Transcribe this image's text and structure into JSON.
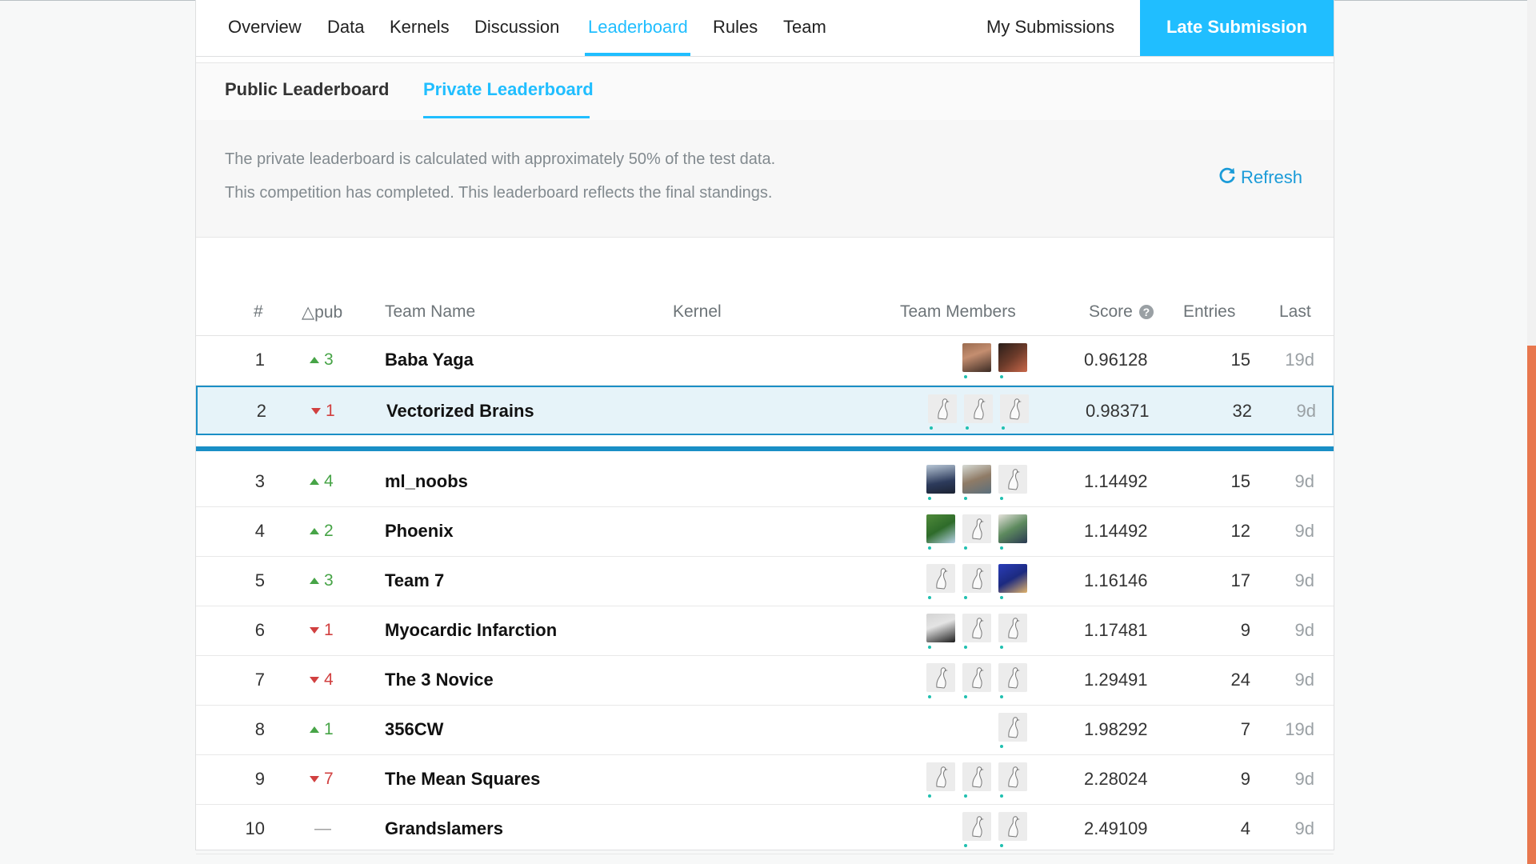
{
  "nav": {
    "tabs": [
      "Overview",
      "Data",
      "Kernels",
      "Discussion",
      "Leaderboard",
      "Rules",
      "Team"
    ],
    "active_tab": "Leaderboard",
    "my_submissions": "My Submissions",
    "late_submission": "Late Submission"
  },
  "subnav": {
    "public": "Public Leaderboard",
    "private": "Private Leaderboard",
    "active": "Private Leaderboard"
  },
  "notice": {
    "line1": "The private leaderboard is calculated with approximately 50% of the test data.",
    "line2": "This competition has completed. This leaderboard reflects the final standings.",
    "refresh": "Refresh"
  },
  "table": {
    "headers": {
      "rank": "#",
      "delta": "△pub",
      "team_name": "Team Name",
      "kernel": "Kernel",
      "members": "Team Members",
      "score": "Score",
      "entries": "Entries",
      "last": "Last"
    },
    "rows": [
      {
        "rank": "1",
        "delta": "3",
        "dir": "up",
        "name": "Baba Yaga",
        "score": "0.96128",
        "entries": "15",
        "last": "19d",
        "avatars": [
          "photo1",
          "photo2"
        ]
      },
      {
        "rank": "2",
        "delta": "1",
        "dir": "down",
        "name": "Vectorized Brains",
        "score": "0.98371",
        "entries": "32",
        "last": "9d",
        "avatars": [
          "goose",
          "goose",
          "goose"
        ]
      },
      {
        "rank": "3",
        "delta": "4",
        "dir": "up",
        "name": "ml_noobs",
        "score": "1.14492",
        "entries": "15",
        "last": "9d",
        "avatars": [
          "photo3",
          "photo4",
          "goose"
        ]
      },
      {
        "rank": "4",
        "delta": "2",
        "dir": "up",
        "name": "Phoenix",
        "score": "1.14492",
        "entries": "12",
        "last": "9d",
        "avatars": [
          "photo5",
          "goose",
          "photo6"
        ]
      },
      {
        "rank": "5",
        "delta": "3",
        "dir": "up",
        "name": "Team 7",
        "score": "1.16146",
        "entries": "17",
        "last": "9d",
        "avatars": [
          "goose",
          "goose",
          "photo7"
        ]
      },
      {
        "rank": "6",
        "delta": "1",
        "dir": "down",
        "name": "Myocardic Infarction",
        "score": "1.17481",
        "entries": "9",
        "last": "9d",
        "avatars": [
          "photo8",
          "goose",
          "goose"
        ]
      },
      {
        "rank": "7",
        "delta": "4",
        "dir": "down",
        "name": "The 3 Novice",
        "score": "1.29491",
        "entries": "24",
        "last": "9d",
        "avatars": [
          "goose",
          "goose",
          "goose"
        ]
      },
      {
        "rank": "8",
        "delta": "1",
        "dir": "up",
        "name": "356CW",
        "score": "1.98292",
        "entries": "7",
        "last": "19d",
        "avatars": [
          "goose"
        ]
      },
      {
        "rank": "9",
        "delta": "7",
        "dir": "down",
        "name": "The Mean Squares",
        "score": "2.28024",
        "entries": "9",
        "last": "9d",
        "avatars": [
          "goose",
          "goose",
          "goose"
        ]
      },
      {
        "rank": "10",
        "delta": "—",
        "dir": "none",
        "name": "Grandslamers",
        "score": "2.49109",
        "entries": "4",
        "last": "9d",
        "avatars": [
          "goose",
          "goose"
        ]
      }
    ]
  }
}
